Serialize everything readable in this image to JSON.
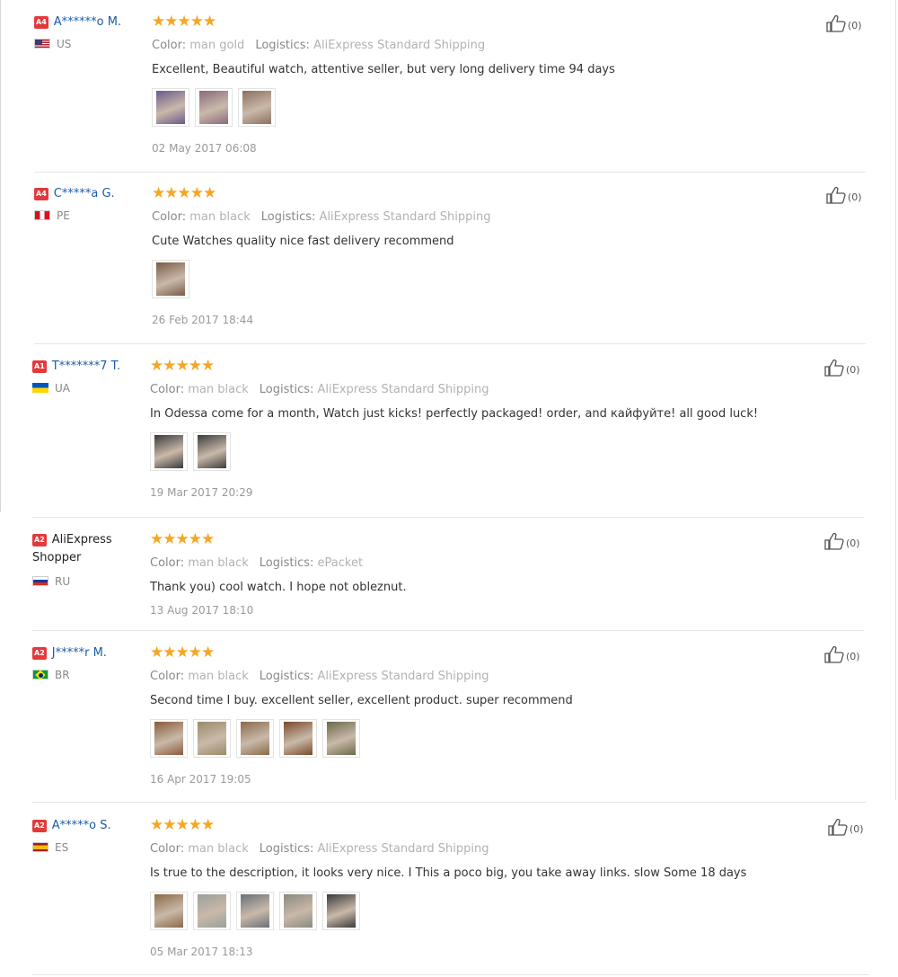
{
  "reviews": [
    {
      "badge": "A4",
      "name": "A******o M.",
      "country": "US",
      "flag": "us",
      "stars": "★★★★★",
      "color_label": "Color:",
      "color_value": "man gold",
      "logistics_label": "Logistics:",
      "logistics_value": "AliExpress Standard Shipping",
      "text": "Excellent, Beautiful watch, attentive seller, but very long delivery time 94 days",
      "photos": [
        "#6a5a8c",
        "#8a6a7a",
        "#8c7060"
      ],
      "date": "02 May 2017 06:08",
      "likes": "(0)"
    },
    {
      "badge": "A4",
      "name": "C*****a G.",
      "country": "PE",
      "flag": "pe",
      "stars": "★★★★★",
      "color_label": "Color:",
      "color_value": "man black",
      "logistics_label": "Logistics:",
      "logistics_value": "AliExpress Standard Shipping",
      "text": "Cute Watches quality nice fast delivery recommend",
      "photos": [
        "#7a5a48"
      ],
      "date": "26 Feb 2017 18:44",
      "likes": "(0)"
    },
    {
      "badge": "A1",
      "name": "T*******7 T.",
      "country": "UA",
      "flag": "ua",
      "stars": "★★★★★",
      "color_label": "Color:",
      "color_value": "man black",
      "logistics_label": "Logistics:",
      "logistics_value": "AliExpress Standard Shipping",
      "text": "In Odessa come for a month, Watch just kicks! perfectly packaged! order, and кайфуйте! all good luck!",
      "photos": [
        "#3a3a3a",
        "#3c3c3c"
      ],
      "date": "19 Mar 2017 20:29",
      "likes": "(0)"
    },
    {
      "badge": "A2",
      "name_line1": "AliExpress",
      "name_line2": "Shopper",
      "country": "RU",
      "flag": "ru",
      "stars": "★★★★★",
      "color_label": "Color:",
      "color_value": "man black",
      "logistics_label": "Logistics:",
      "logistics_value": "ePacket",
      "text": "Thank you) cool watch. I hope not obleznut.",
      "photos": [],
      "date": "13 Aug 2017 18:10",
      "likes": "(0)"
    },
    {
      "badge": "A2",
      "name": "J*****r M.",
      "country": "BR",
      "flag": "br",
      "stars": "★★★★★",
      "color_label": "Color:",
      "color_value": "man black",
      "logistics_label": "Logistics:",
      "logistics_value": "AliExpress Standard Shipping",
      "text": "Second time I buy. excellent seller, excellent product. super recommend",
      "photos": [
        "#8a5a3a",
        "#9a8a6a",
        "#8a6a4a",
        "#7a4a2a",
        "#6a6a4a"
      ],
      "date": "16 Apr 2017 19:05",
      "likes": "(0)"
    },
    {
      "badge": "A2",
      "name": "A*****o S.",
      "country": "ES",
      "flag": "es",
      "stars": "★★★★★",
      "color_label": "Color:",
      "color_value": "man black",
      "logistics_label": "Logistics:",
      "logistics_value": "AliExpress Standard Shipping",
      "text": "Is true to the description, it looks very nice. I This a poco big, you take away links. slow Some 18 days",
      "photos": [
        "#8a6a4a",
        "#9aa09a",
        "#6a7078",
        "#8a8a80",
        "#3a3a3a"
      ],
      "date": "05 Mar 2017 18:13",
      "likes": "(0)"
    }
  ]
}
